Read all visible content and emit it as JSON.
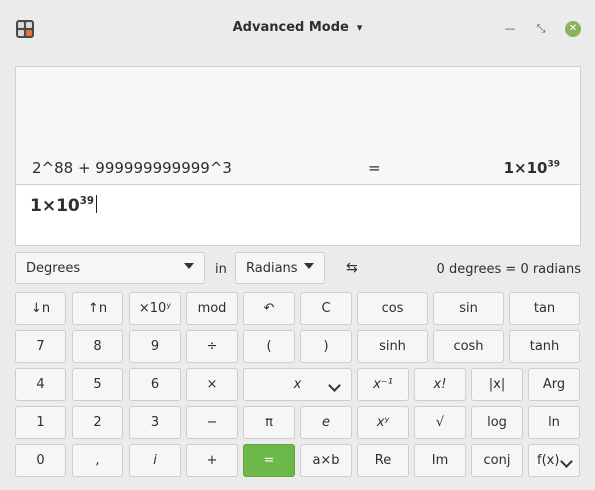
{
  "window": {
    "title": "Advanced Mode"
  },
  "history": {
    "equation": "2^88 + 999999999999^3",
    "equals": "=",
    "result_mantissa": "1×10",
    "result_exp": "39"
  },
  "entry": {
    "mantissa": "1×10",
    "exp": "39"
  },
  "conversion": {
    "from_unit": "Degrees",
    "in_label": "in",
    "to_unit": "Radians",
    "swap_icon": "⇆",
    "text": "0 degrees  =  0 radians"
  },
  "buttons": {
    "r1": [
      "↓n",
      "↑n",
      "×10ʸ",
      "mod",
      "↶",
      "C",
      "cos",
      "sin",
      "tan"
    ],
    "r2": [
      "7",
      "8",
      "9",
      "÷",
      "(",
      ")",
      "sinh",
      "cosh",
      "tanh"
    ],
    "r3": [
      "4",
      "5",
      "6",
      "×",
      "x",
      "x⁻¹",
      "x!",
      "|x|",
      "Arg"
    ],
    "r4": [
      "1",
      "2",
      "3",
      "−",
      "π",
      "e",
      "xʸ",
      "√",
      "log",
      "ln"
    ],
    "r5": [
      "0",
      ",",
      "i",
      "+",
      "=",
      "a×b",
      "Re",
      "Im",
      "conj",
      "f(x)"
    ]
  }
}
